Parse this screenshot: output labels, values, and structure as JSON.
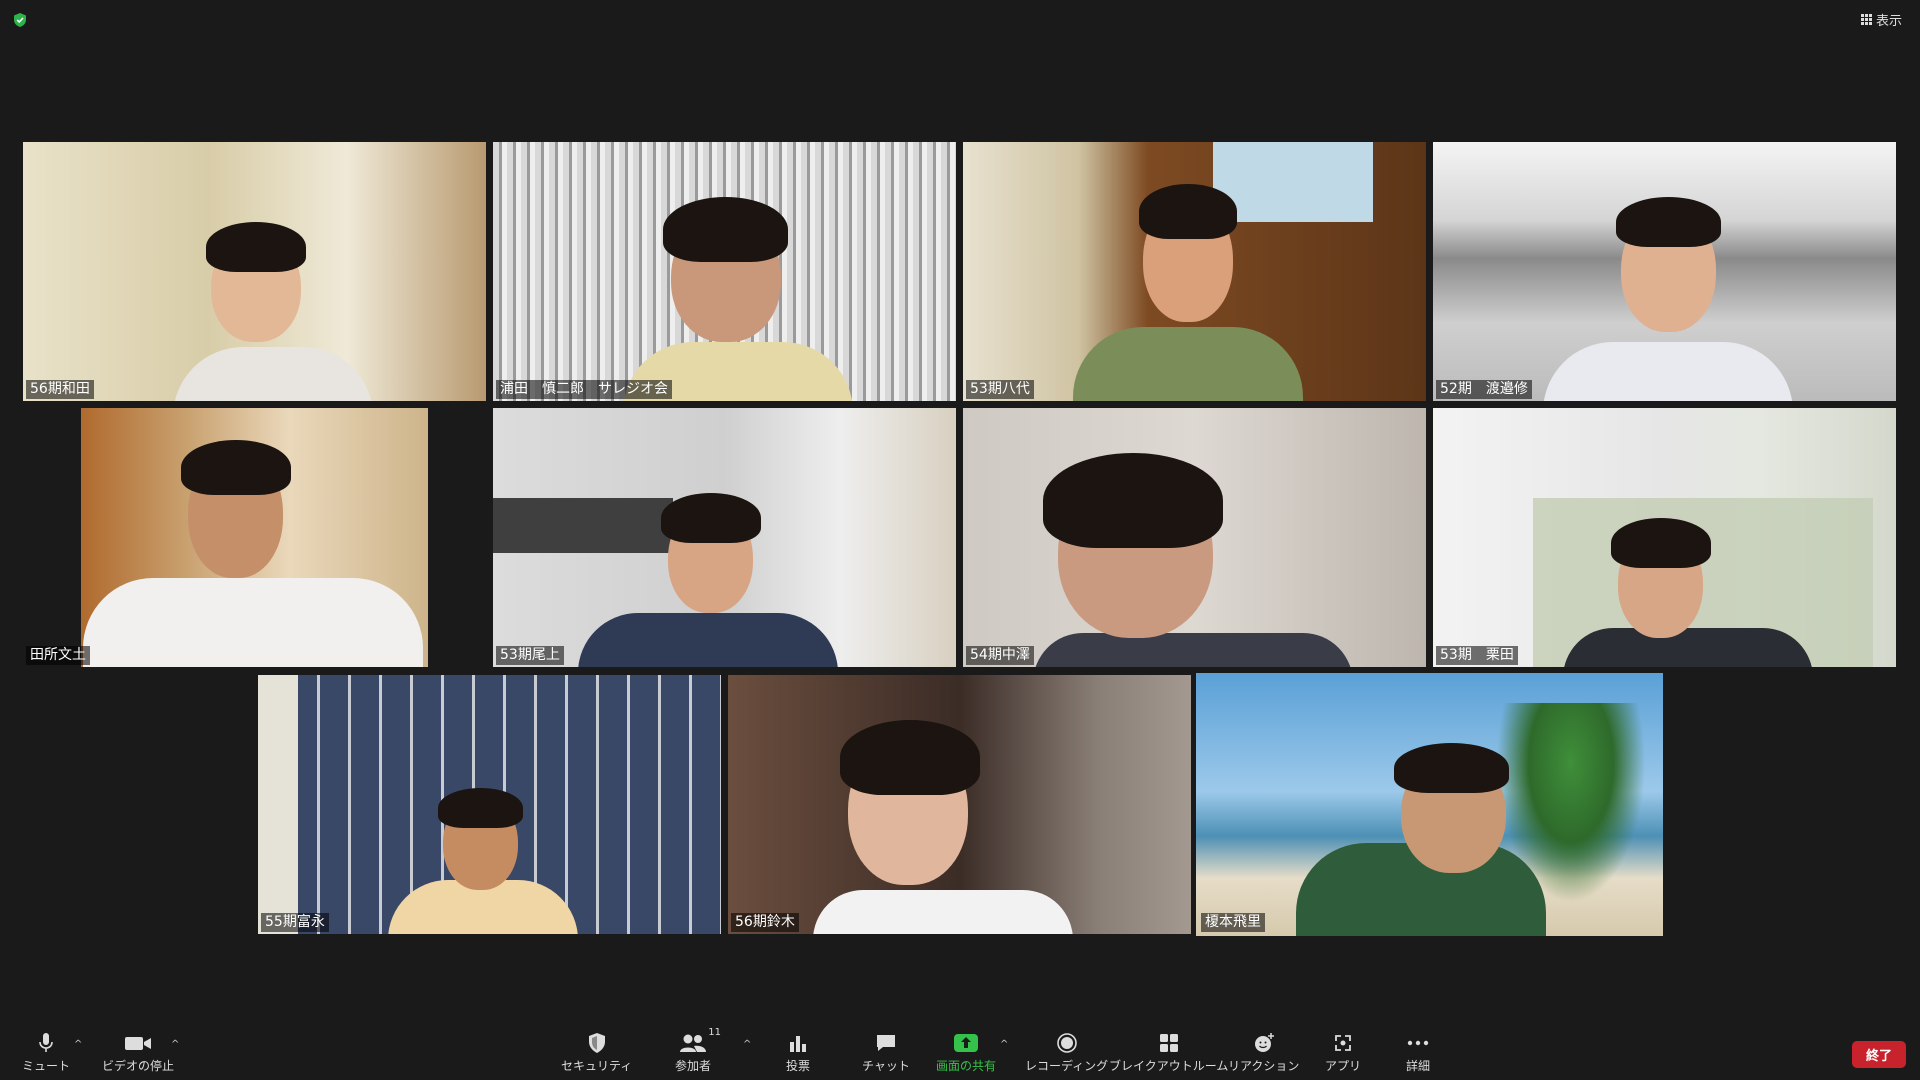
{
  "header": {
    "view_label": "表示"
  },
  "participants": [
    {
      "name": "56期和田"
    },
    {
      "name": "浦田　慎二郎　サレジオ会"
    },
    {
      "name": "53期八代"
    },
    {
      "name": "52期　渡邉修"
    },
    {
      "name": "田所文土"
    },
    {
      "name": "53期尾上"
    },
    {
      "name": "54期中澤"
    },
    {
      "name": "53期　栗田"
    },
    {
      "name": "55期富永"
    },
    {
      "name": "56期鈴木"
    },
    {
      "name": "榎本飛里"
    }
  ],
  "toolbar": {
    "mute": "ミュート",
    "video": "ビデオの停止",
    "security": "セキュリティ",
    "participants": "参加者",
    "participants_count": "11",
    "polls": "投票",
    "chat": "チャット",
    "share": "画面の共有",
    "record": "レコーディング",
    "breakout": "ブレイクアウトルーム",
    "reactions": "リアクション",
    "apps": "アプリ",
    "more": "詳細",
    "end": "終了"
  },
  "colors": {
    "active_speaker": "#e6e14a",
    "share_green": "#35c24a",
    "end_red": "#c8232c",
    "shield_green": "#2db34a"
  }
}
